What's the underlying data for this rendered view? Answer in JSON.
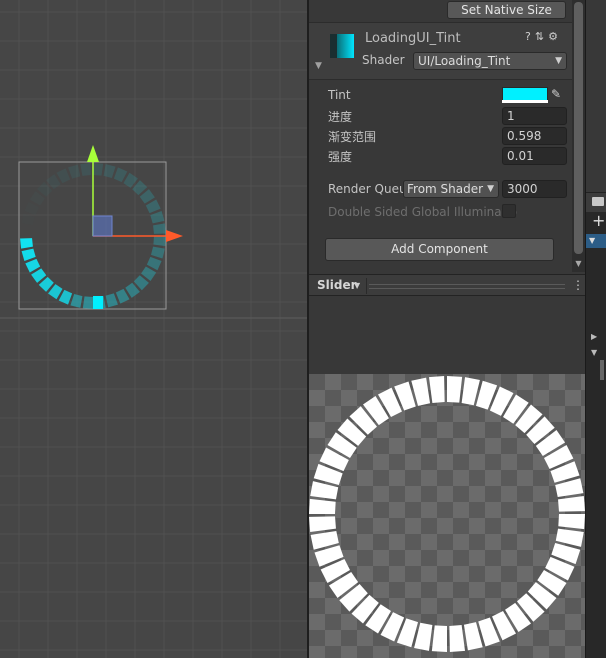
{
  "inspector": {
    "set_native_size": "Set Native Size",
    "material": {
      "name": "LoadingUI_Tint",
      "shader_label": "Shader",
      "shader_value": "UI/Loading_Tint"
    },
    "properties": {
      "tint_label": "Tint",
      "tint_color": "#00f0ff",
      "progress_label": "进度",
      "progress_value": "1",
      "gradient_label": "渐变范围",
      "gradient_value": "0.598",
      "intensity_label": "强度",
      "intensity_value": "0.01",
      "render_queue_label": "Render Queu",
      "render_queue_mode": "From Shader",
      "render_queue_value": "3000",
      "double_sided_label": "Double Sided Global Illuminatio"
    },
    "add_component": "Add Component"
  },
  "slider_bar": {
    "label": "Slider"
  },
  "colors": {
    "accent_cyan": "#00f0ff",
    "gizmo_x": "#ff5a2a",
    "gizmo_y": "#a8ff3a",
    "selection_blue": "#2c5d87"
  },
  "icons": {
    "help": "help-icon",
    "preset": "preset-icon",
    "settings": "gear-icon",
    "eyedropper": "eyedropper-icon",
    "menu": "kebab-menu-icon",
    "add": "plus-icon",
    "folder": "folder-icon"
  }
}
